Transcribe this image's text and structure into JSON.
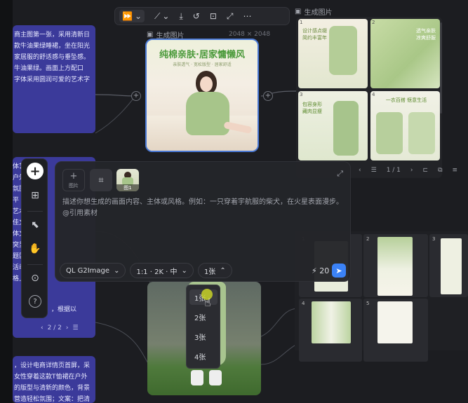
{
  "toolbar": {
    "play_icon": "⏩",
    "chevron": "⌄",
    "branch_icon": "⟋",
    "download_icon": "⤓",
    "history_icon": "↺",
    "focus_icon": "⊡",
    "expand_icon": "⤢",
    "more_icon": "⋯"
  },
  "node1": {
    "label": "生成图片",
    "dimensions": "2048 × 2048",
    "title": "纯棉亲肤·居家慵懒风",
    "subtitle": "亲肤透气 · 宽松版型 · 居家舒适"
  },
  "gallery": {
    "label": "生成图片",
    "pager": "1 / 1",
    "tiles": [
      {
        "num": "1",
        "text": "设计感点缀 简约丰富年"
      },
      {
        "num": "2",
        "text": "透气亲肤 凉爽舒服"
      },
      {
        "num": "3",
        "text": "包容身形 藏肉显瘦"
      },
      {
        "num": "4",
        "text": "一衣百搭 惬意生活"
      }
    ]
  },
  "gallery2": {
    "tiles": [
      "1",
      "2",
      "3",
      "4",
      "5"
    ]
  },
  "text_nodes": {
    "top": [
      "商主图第一张，采用清新日",
      "款牛油果绿睡裙，坐在阳光",
      "家居服的舒适感与垂坠感。",
      "牛油果绿。画面上方配口",
      "字体采用圆润可爱的艺术字"
    ],
    "middle": [
      "体艺",
      "户外",
      "氛围",
      "平",
      "艺术",
      "佳文",
      "",
      "体文",
      "突显",
      "题区",
      "活动",
      "格上",
      "根",
      "字样"
    ],
    "middle_pager": "2 / 2",
    "middle_tail": "，根据以",
    "bottom": [
      "，设计电商详情页首屏，采",
      "女性穿着这款T恤裙在户外",
      "的版型与清新的颜色，背景",
      "营造轻松氛围；文案：把清新"
    ]
  },
  "prompt": {
    "add_label": "图片",
    "add_plus": "+",
    "ref_caption": "图1",
    "placeholder": "描述你想生成的画面内容、主体或风格。例如：一只穿着宇航服的柴犬，在火星表面漫步。",
    "placeholder2": "@引用素材",
    "model": "QL G2Image",
    "ratio": "1:1 · 2K · 中",
    "count": "1张",
    "credits": "20",
    "credit_icon": "⚡",
    "send_icon": "➤"
  },
  "count_menu": {
    "options": [
      "1张",
      "2张",
      "3张",
      "4张"
    ],
    "selected": "1张"
  },
  "rail": {
    "add": "+",
    "grid": "⊞",
    "select": "⬉",
    "hand": "✋",
    "camera": "⊙",
    "help": "?"
  }
}
